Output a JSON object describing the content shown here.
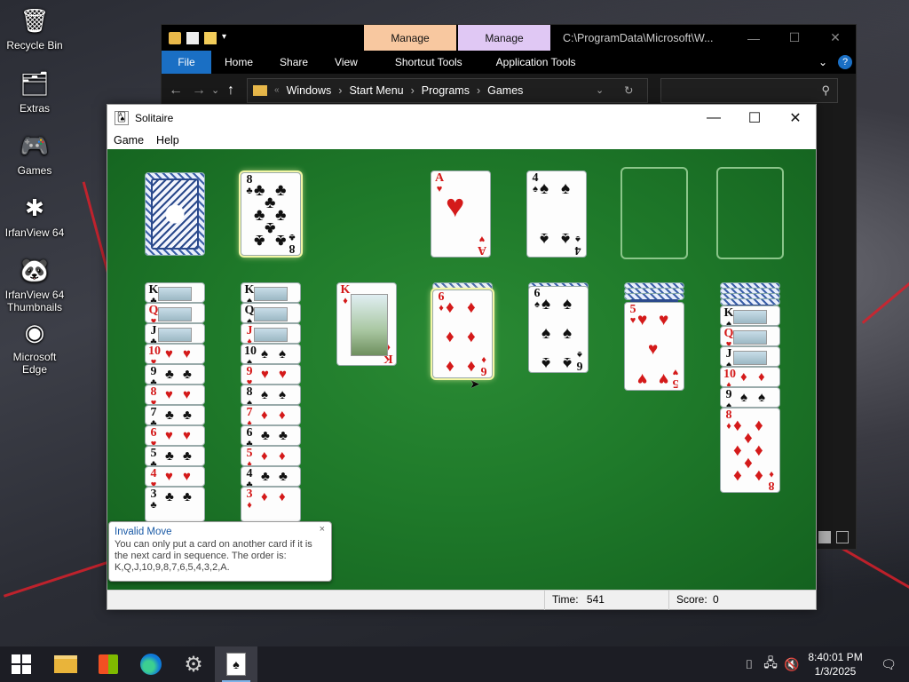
{
  "desktop": {
    "icons": [
      {
        "label": "Recycle Bin",
        "glyph": "🗑"
      },
      {
        "label": "Extras",
        "glyph": "🗂"
      },
      {
        "label": "Games",
        "glyph": "🎮"
      },
      {
        "label": "IrfanView 64",
        "glyph": "✱"
      },
      {
        "label": "IrfanView 64 Thumbnails",
        "glyph": "🐼"
      },
      {
        "label": "Microsoft Edge",
        "glyph": "◉"
      }
    ]
  },
  "explorer": {
    "manage1": "Manage",
    "manage2": "Manage",
    "path": "C:\\ProgramData\\Microsoft\\W...",
    "tabs": {
      "file": "File",
      "home": "Home",
      "share": "Share",
      "view": "View",
      "shortcut_tools": "Shortcut Tools",
      "application_tools": "Application Tools"
    },
    "breadcrumb": [
      "Windows",
      "Start Menu",
      "Programs",
      "Games"
    ],
    "colors": {
      "manage1": "#f8c8a0",
      "manage2": "#e0c8f4",
      "file_tab": "#1a6fc4"
    }
  },
  "solitaire": {
    "title": "Solitaire",
    "menu": {
      "game": "Game",
      "help": "Help"
    },
    "status": {
      "time_label": "Time:",
      "time_value": "541",
      "score_label": "Score:",
      "score_value": "0"
    },
    "felt_color": "#1f7a2a",
    "waste_top": {
      "rank": "8",
      "suit": "♣"
    },
    "foundations": [
      {
        "rank": "A",
        "suit": "♥"
      },
      {
        "rank": "4",
        "suit": "♠"
      }
    ],
    "tableau": {
      "col1": [
        {
          "rank": "K",
          "suit": "♣"
        },
        {
          "rank": "Q",
          "suit": "♥"
        },
        {
          "rank": "J",
          "suit": "♣"
        },
        {
          "rank": "10",
          "suit": "♥"
        },
        {
          "rank": "9",
          "suit": "♣"
        },
        {
          "rank": "8",
          "suit": "♥"
        },
        {
          "rank": "7",
          "suit": "♣"
        },
        {
          "rank": "6",
          "suit": "♥"
        },
        {
          "rank": "5",
          "suit": "♣"
        },
        {
          "rank": "4",
          "suit": "♥"
        },
        {
          "rank": "3",
          "suit": "♣"
        }
      ],
      "col2": [
        {
          "rank": "K",
          "suit": "♠"
        },
        {
          "rank": "Q",
          "suit": "♠"
        },
        {
          "rank": "J",
          "suit": "♦"
        },
        {
          "rank": "10",
          "suit": "♠"
        },
        {
          "rank": "9",
          "suit": "♥"
        },
        {
          "rank": "8",
          "suit": "♠"
        },
        {
          "rank": "7",
          "suit": "♦"
        },
        {
          "rank": "6",
          "suit": "♣"
        },
        {
          "rank": "5",
          "suit": "♦"
        },
        {
          "rank": "4",
          "suit": "♣"
        },
        {
          "rank": "3",
          "suit": "♦"
        }
      ],
      "col3": [
        {
          "rank": "K",
          "suit": "♦"
        }
      ],
      "col4": [
        {
          "rank": "6",
          "suit": "♦"
        }
      ],
      "col5": [
        {
          "rank": "6",
          "suit": "♠"
        }
      ],
      "col6": [
        {
          "rank": "5",
          "suit": "♥"
        }
      ],
      "col7": [
        {
          "rank": "K",
          "suit": "♠"
        },
        {
          "rank": "Q",
          "suit": "♥"
        },
        {
          "rank": "J",
          "suit": "♠"
        },
        {
          "rank": "10",
          "suit": "♦"
        },
        {
          "rank": "9",
          "suit": "♠"
        },
        {
          "rank": "8",
          "suit": "♦"
        }
      ]
    },
    "balloon": {
      "title": "Invalid Move",
      "text": "You can only put a card on another card if it is the next card in sequence. The order is: K,Q,J,10,9,8,7,6,5,4,3,2,A.",
      "close": "×"
    }
  },
  "taskbar": {
    "clock_time": "8:40:01 PM",
    "clock_date": "1/3/2025"
  }
}
